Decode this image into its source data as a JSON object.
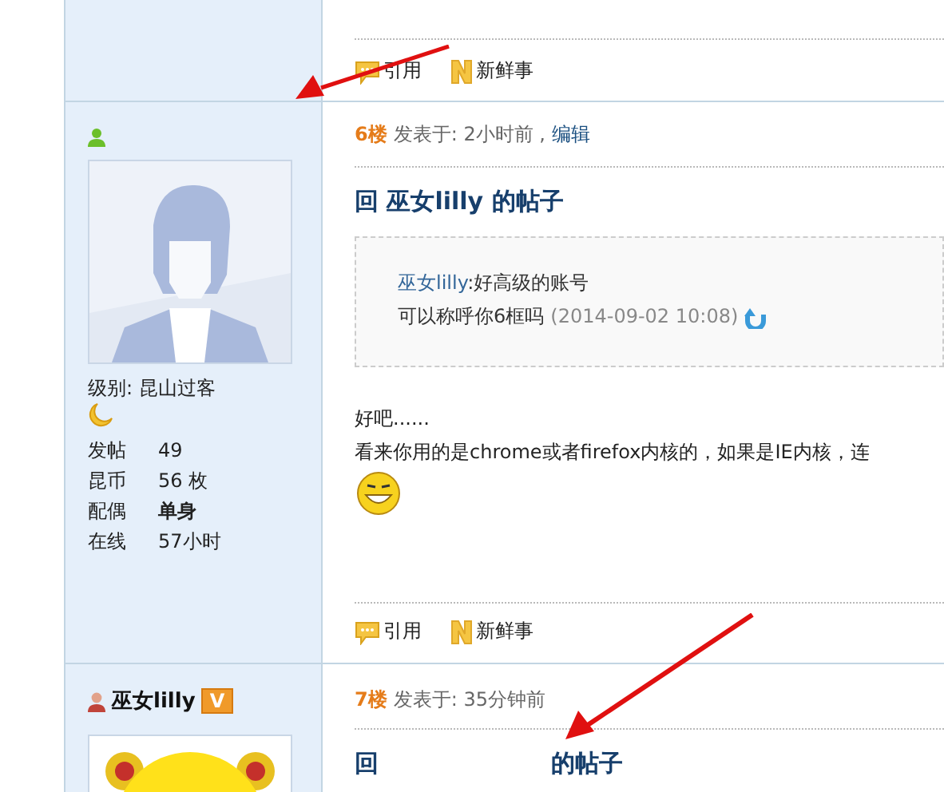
{
  "previous_post": {
    "actions": [
      {
        "kind": "quote",
        "label": "引用"
      },
      {
        "kind": "news",
        "label": "新鲜事"
      }
    ]
  },
  "posts": [
    {
      "author": {
        "online": true,
        "level": "级别: 昆山过客",
        "stats": [
          {
            "label": "发帖",
            "value": "49",
            "bold": false
          },
          {
            "label": "昆币",
            "value": "56 枚",
            "bold": false
          },
          {
            "label": "配偶",
            "value": "单身",
            "bold": true
          },
          {
            "label": "在线",
            "value": "57小时",
            "bold": false
          }
        ]
      },
      "floor": "6楼",
      "meta": "发表于: 2小时前 ,",
      "edit_link": "编辑",
      "title": [
        "回 巫女lilly 的帖子"
      ],
      "quote": {
        "user": "巫女lilly",
        "text": ":好高级的账号",
        "line2": "可以称呼你6框吗",
        "date": "(2014-09-02 10:08)"
      },
      "body": [
        "好吧......",
        "看来你用的是chrome或者firefox内核的，如果是IE内核，连"
      ],
      "emoji": true,
      "actions": [
        {
          "kind": "quote",
          "label": "引用"
        },
        {
          "kind": "news",
          "label": "新鲜事"
        }
      ]
    },
    {
      "author": {
        "online": false,
        "name": "巫女lilly",
        "vip_badge": "V",
        "avatar": {
          "kind": "cartoon"
        }
      },
      "floor": "7楼",
      "meta": "发表于: 35分钟前",
      "title": [
        "回",
        "的帖子"
      ]
    }
  ]
}
